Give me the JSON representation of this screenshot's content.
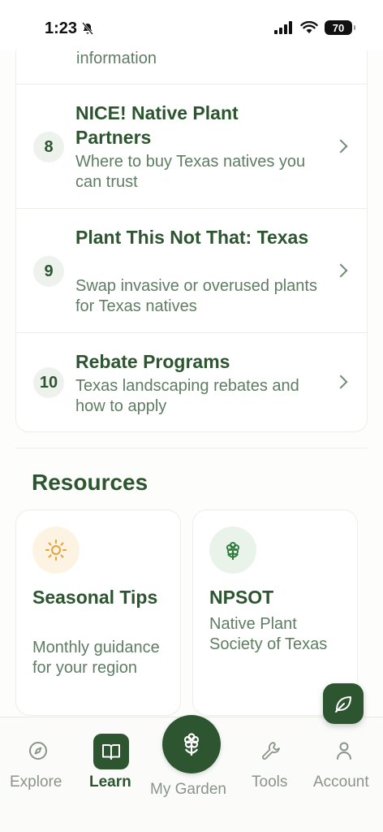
{
  "status_bar": {
    "time": "1:23",
    "battery": "70"
  },
  "list": {
    "partial_text": "information",
    "items": [
      {
        "number": "8",
        "title": "NICE! Native Plant Partners",
        "description": "Where to buy Texas natives you can trust"
      },
      {
        "number": "9",
        "title": "Plant This Not That: Texas",
        "description": "Swap invasive or overused plants for Texas natives"
      },
      {
        "number": "10",
        "title": "Rebate Programs",
        "description": "Texas landscaping rebates and how to apply"
      }
    ]
  },
  "resources": {
    "title": "Resources",
    "cards": [
      {
        "title": "Seasonal Tips",
        "description": "Monthly guidance for your region",
        "icon": "sun-icon"
      },
      {
        "title": "NPSOT",
        "description": "Native Plant Society of Texas",
        "icon": "flower-icon"
      }
    ]
  },
  "nav": {
    "items": [
      {
        "label": "Explore",
        "icon": "compass-icon"
      },
      {
        "label": "Learn",
        "icon": "book-icon"
      },
      {
        "label": "My Garden",
        "icon": "flower-icon"
      },
      {
        "label": "Tools",
        "icon": "wrench-icon"
      },
      {
        "label": "Account",
        "icon": "user-icon"
      }
    ]
  },
  "colors": {
    "primary": "#2c5530",
    "muted": "#5e7d62",
    "badge_bg": "#eef2ec",
    "sun_bg": "#fdf3e3",
    "sun": "#e8a23a",
    "leaf_bg": "#e9f3ea"
  }
}
